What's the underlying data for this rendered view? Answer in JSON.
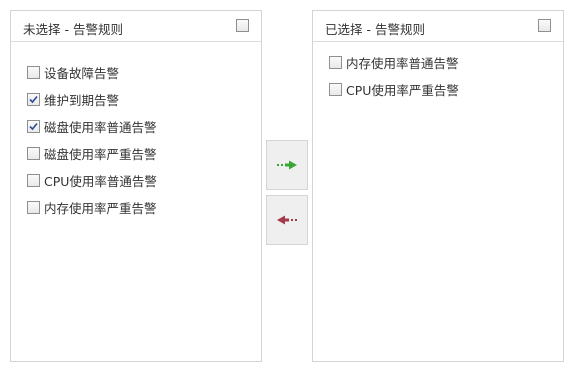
{
  "left_panel": {
    "title": "未选择 - 告警规则",
    "select_all_checked": false,
    "items": [
      {
        "label": "设备故障告警",
        "checked": false
      },
      {
        "label": "维护到期告警",
        "checked": true
      },
      {
        "label": "磁盘使用率普通告警",
        "checked": true
      },
      {
        "label": "磁盘使用率严重告警",
        "checked": false
      },
      {
        "label": "CPU使用率普通告警",
        "checked": false
      },
      {
        "label": "内存使用率严重告警",
        "checked": false
      }
    ]
  },
  "right_panel": {
    "title": "已选择 - 告警规则",
    "select_all_checked": false,
    "items": [
      {
        "label": "内存使用率普通告警",
        "checked": false
      },
      {
        "label": "CPU使用率严重告警",
        "checked": false
      }
    ]
  },
  "buttons": {
    "move_right_icon": "arrow-right-icon",
    "move_right_color": "#3aa635",
    "move_left_icon": "arrow-left-icon",
    "move_left_color": "#a23a4a"
  }
}
